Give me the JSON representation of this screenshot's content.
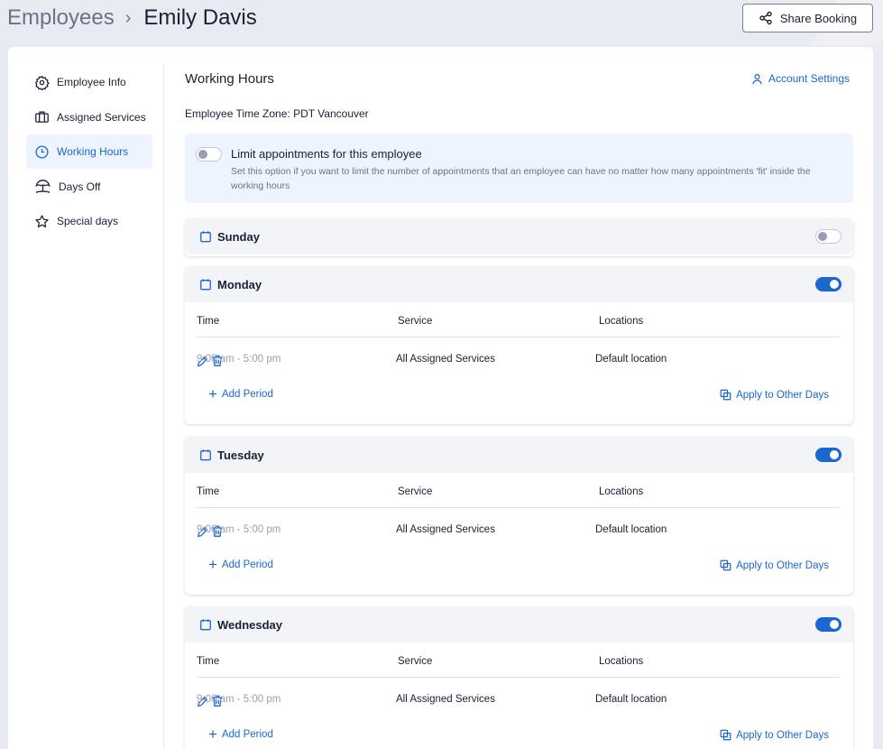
{
  "breadcrumb": {
    "root": "Employees",
    "separator": "›",
    "current": "Emily Davis"
  },
  "header": {
    "share_label": "Share Booking",
    "share_icon": "share-icon"
  },
  "sidebar": {
    "items": [
      {
        "label": "Employee Info",
        "icon": "gear-icon",
        "active": false
      },
      {
        "label": "Assigned Services",
        "icon": "briefcase-icon",
        "active": false
      },
      {
        "label": "Working Hours",
        "icon": "clock-icon",
        "active": true
      },
      {
        "label": "Days Off",
        "icon": "beach-umbrella-icon",
        "active": false
      },
      {
        "label": "Special days",
        "icon": "star-icon",
        "active": false
      }
    ]
  },
  "main": {
    "title": "Working Hours",
    "account_settings": "Account Settings",
    "timezone_label": "Employee Time Zone:",
    "timezone_value": "PDT Vancouver",
    "limit": {
      "enabled": false,
      "title": "Limit appointments for this employee",
      "description": "Set this option if you want to limit the number of appointments that an employee can have no matter how many appointments 'fit' inside the working hours"
    },
    "columns": {
      "time": "Time",
      "service": "Service",
      "locations": "Locations"
    },
    "add_period": "Add Period",
    "apply_other": "Apply to Other Days",
    "days": [
      {
        "name": "Sunday",
        "enabled": false,
        "periods": []
      },
      {
        "name": "Monday",
        "enabled": true,
        "periods": [
          {
            "time": "9:00 am - 5:00 pm",
            "service": "All Assigned Services",
            "location": "Default location"
          }
        ]
      },
      {
        "name": "Tuesday",
        "enabled": true,
        "periods": [
          {
            "time": "9:00 am - 5:00 pm",
            "service": "All Assigned Services",
            "location": "Default location"
          }
        ]
      },
      {
        "name": "Wednesday",
        "enabled": true,
        "periods": [
          {
            "time": "9:00 am - 5:00 pm",
            "service": "All Assigned Services",
            "location": "Default location"
          }
        ]
      }
    ]
  },
  "colors": {
    "accent": "#1a66d2",
    "active_bg": "#eef4fd"
  }
}
